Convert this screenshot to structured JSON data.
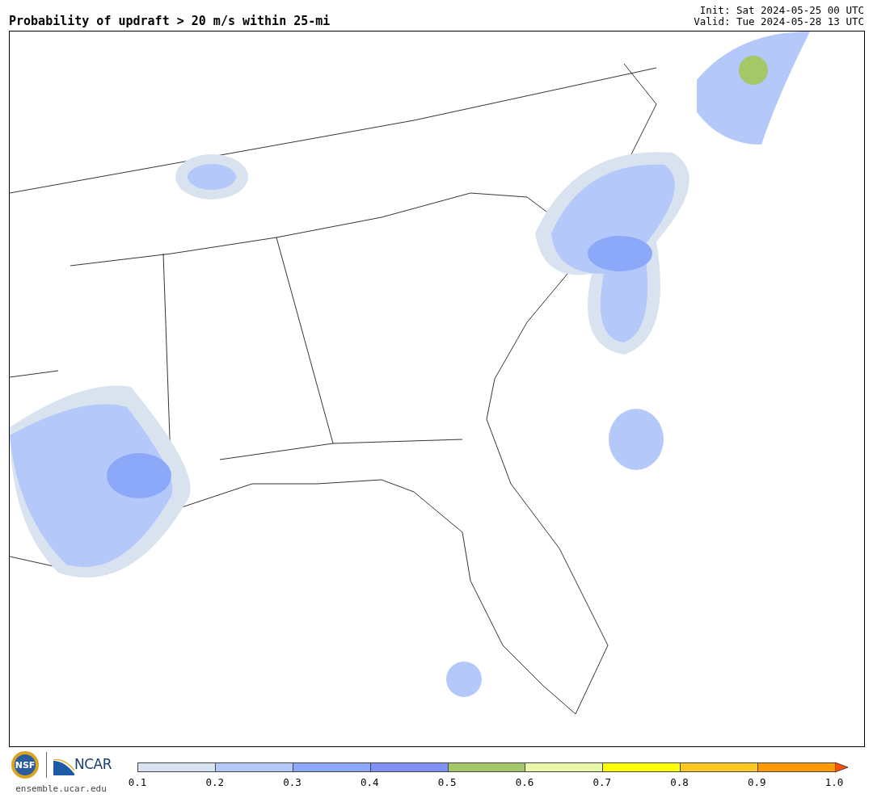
{
  "title": "Probability of updraft > 20 m/s within 25-mi",
  "init": "Init: Sat 2024-05-25 00 UTC",
  "valid": "Valid: Tue 2024-05-28 13 UTC",
  "logos": {
    "nsf": "NSF",
    "ncar": "NCAR",
    "site": "ensemble.ucar.edu"
  },
  "colorbar": {
    "bins": [
      {
        "color": "#d8e3ef"
      },
      {
        "color": "#b4c8fa"
      },
      {
        "color": "#8ca8f8"
      },
      {
        "color": "#7f90f8"
      },
      {
        "color": "#a4c868"
      },
      {
        "color": "#e8f8a8"
      },
      {
        "color": "#ffff00"
      },
      {
        "color": "#ffc820"
      },
      {
        "color": "#ff9a00"
      }
    ],
    "extend": {
      "color": "#ff5000"
    },
    "ticks": [
      "0.1",
      "0.2",
      "0.3",
      "0.4",
      "0.5",
      "0.6",
      "0.7",
      "0.8",
      "0.9",
      "1.0"
    ]
  }
}
